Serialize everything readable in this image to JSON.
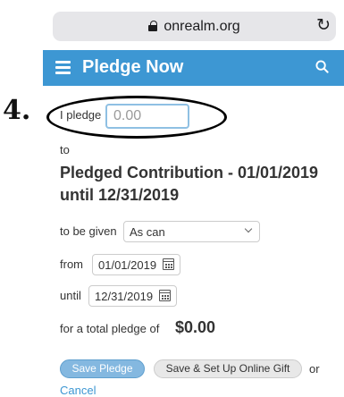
{
  "browser": {
    "url": "onrealm.org"
  },
  "app_bar": {
    "title": "Pledge Now",
    "color": "#3d97d3"
  },
  "annotation": {
    "step": "4."
  },
  "form": {
    "pledge_label": "I pledge",
    "amount_placeholder": "0.00",
    "to_label": "to",
    "contribution_title": "Pledged Contribution - 01/01/2019 until 12/31/2019",
    "given_label": "to be given",
    "frequency_value": "As can",
    "from_label": "from",
    "from_date": "01/01/2019",
    "until_label": "until",
    "until_date": "12/31/2019",
    "total_label": "for a total pledge of",
    "total_value": "$0.00"
  },
  "actions": {
    "save_label": "Save Pledge",
    "gift_label": "Save & Set Up Online Gift",
    "or_label": "or",
    "cancel_label": "Cancel"
  }
}
